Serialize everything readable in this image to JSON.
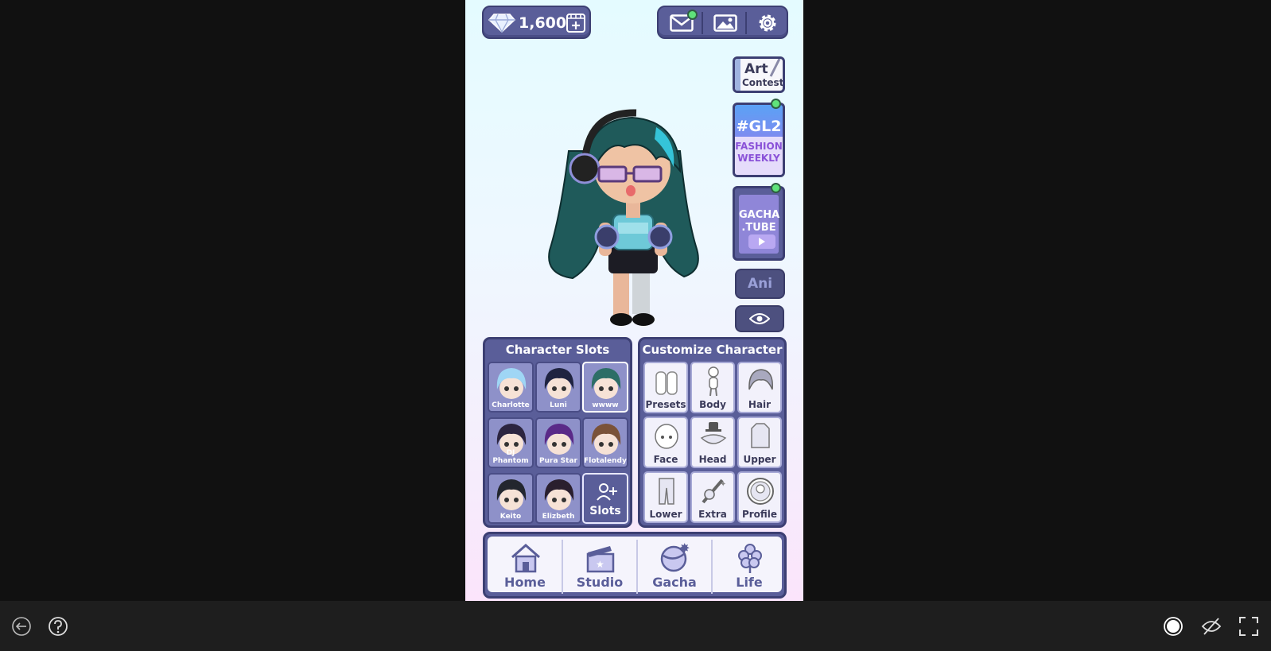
{
  "currency": {
    "amount": "1,600",
    "gem_icon": "diamond-icon",
    "add_icon": "film-plus-icon"
  },
  "top_buttons": [
    {
      "name": "mail",
      "icon": "mail-icon",
      "notification": true
    },
    {
      "name": "gallery",
      "icon": "image-icon"
    },
    {
      "name": "settings",
      "icon": "gear-icon"
    }
  ],
  "side_cards": {
    "art_contest": {
      "line1": "Art",
      "line2": "Contest"
    },
    "gl2": {
      "tag": "#GL2",
      "line1": "FASHION",
      "line2": "WEEKLY",
      "notification": true
    },
    "gacha_tube": {
      "line1": "GACHA",
      "line2": ".TUBE",
      "notification": true
    }
  },
  "ani_label": "Ani",
  "character_slots": {
    "title": "Character Slots",
    "slots": [
      {
        "name": "Charlotte",
        "hair": "#9fd6f5"
      },
      {
        "name": "Luni",
        "hair": "#1f2340"
      },
      {
        "name": "wwww",
        "hair": "#2d6e66",
        "selected": true
      },
      {
        "name": "DJ Phantom",
        "hair": "#2c2540"
      },
      {
        "name": "Pura Star",
        "hair": "#5a2a88"
      },
      {
        "name": "Flotalendy",
        "hair": "#7a5238"
      },
      {
        "name": "Keito",
        "hair": "#23262e"
      },
      {
        "name": "Elizbeth",
        "hair": "#2a1f2e"
      }
    ],
    "add_label": "Slots"
  },
  "customize": {
    "title": "Customize Character",
    "buttons": [
      "Presets",
      "Body",
      "Hair",
      "Face",
      "Head",
      "Upper",
      "Lower",
      "Extra",
      "Profile"
    ]
  },
  "nav": [
    "Home",
    "Studio",
    "Gacha",
    "Life"
  ],
  "colors": {
    "panel": "#5a5e99",
    "border": "#3c3f73",
    "notify": "#5fe37a",
    "accent": "#8a52d8"
  }
}
